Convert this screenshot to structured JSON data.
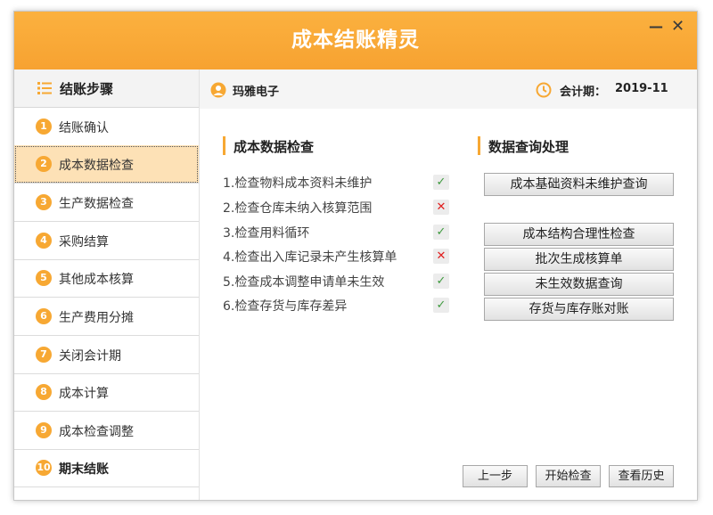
{
  "window": {
    "title": "成本结账精灵",
    "minimize_label": "—",
    "close_label": "✕"
  },
  "sidebar": {
    "title": "结账步骤",
    "icon": "list-icon",
    "steps": [
      {
        "num": "1",
        "label": "结账确认"
      },
      {
        "num": "2",
        "label": "成本数据检查"
      },
      {
        "num": "3",
        "label": "生产数据检查"
      },
      {
        "num": "4",
        "label": "采购结算"
      },
      {
        "num": "5",
        "label": "其他成本核算"
      },
      {
        "num": "6",
        "label": "生产费用分摊"
      },
      {
        "num": "7",
        "label": "关闭会计期"
      },
      {
        "num": "8",
        "label": "成本计算"
      },
      {
        "num": "9",
        "label": "成本检查调整"
      },
      {
        "num": "10",
        "label": "期末结账"
      }
    ],
    "active_step": "2"
  },
  "header": {
    "company": "玛雅电子",
    "period_label": "会计期：",
    "period_value": "2019-11"
  },
  "checks": {
    "title": "成本数据检查",
    "items": [
      {
        "label": "1.检查物料成本资料未维护",
        "status": "ok",
        "mark": "✓"
      },
      {
        "label": "2.检查仓库未纳入核算范围",
        "status": "err",
        "mark": "✕"
      },
      {
        "label": "3.检查用料循环",
        "status": "ok",
        "mark": "✓"
      },
      {
        "label": "4.检查出入库记录未产生核算单",
        "status": "err",
        "mark": "✕"
      },
      {
        "label": "5.检查成本调整申请单未生效",
        "status": "ok",
        "mark": "✓"
      },
      {
        "label": "6.检查存货与库存差异",
        "status": "ok",
        "mark": "✓"
      }
    ]
  },
  "queries": {
    "title": "数据查询处理",
    "buttons": [
      "成本基础资料未维护查询",
      "成本结构合理性检查",
      "批次生成核算单",
      "未生效数据查询",
      "存货与库存账对账"
    ]
  },
  "footer": {
    "prev_label": "上一步",
    "start_label": "开始检查",
    "history_label": "查看历史"
  },
  "colors": {
    "accent": "#f7a833",
    "title_bar": "#fbb13f",
    "active_step_bg": "#fde1b6",
    "ok": "#3f9a3f",
    "error": "#e02020"
  }
}
